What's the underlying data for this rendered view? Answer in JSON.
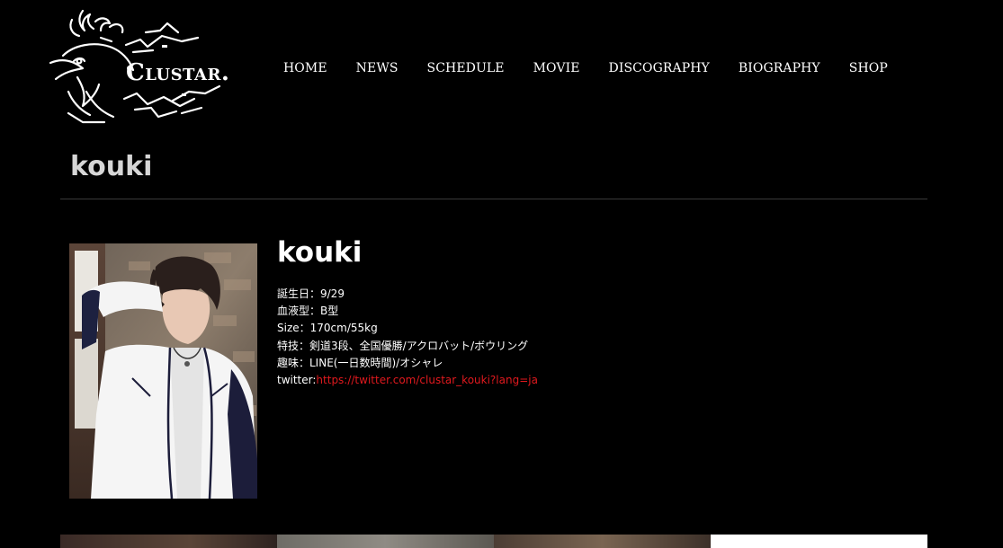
{
  "brand": {
    "name": "Clustar."
  },
  "nav": [
    {
      "label": "HOME"
    },
    {
      "label": "NEWS"
    },
    {
      "label": "SCHEDULE"
    },
    {
      "label": "MOVIE"
    },
    {
      "label": "DISCOGRAPHY"
    },
    {
      "label": "BIOGRAPHY"
    },
    {
      "label": "SHOP"
    }
  ],
  "page": {
    "title": "kouki"
  },
  "profile": {
    "name": "kouki",
    "birthday": "誕生日：9/29",
    "blood_type": "血液型：B型",
    "size": "Size：170cm/55kg",
    "skills": "特技：剣道3段、全国優勝/アクロバット/ボウリング",
    "hobbies": "趣味：LINE(一日数時間)/オシャレ",
    "twitter_label": "twitter:",
    "twitter_url": "https://twitter.com/clustar_kouki?lang=ja"
  },
  "colors": {
    "background": "#000000",
    "title_text": "#d6d6d6",
    "link": "#e0191e"
  }
}
